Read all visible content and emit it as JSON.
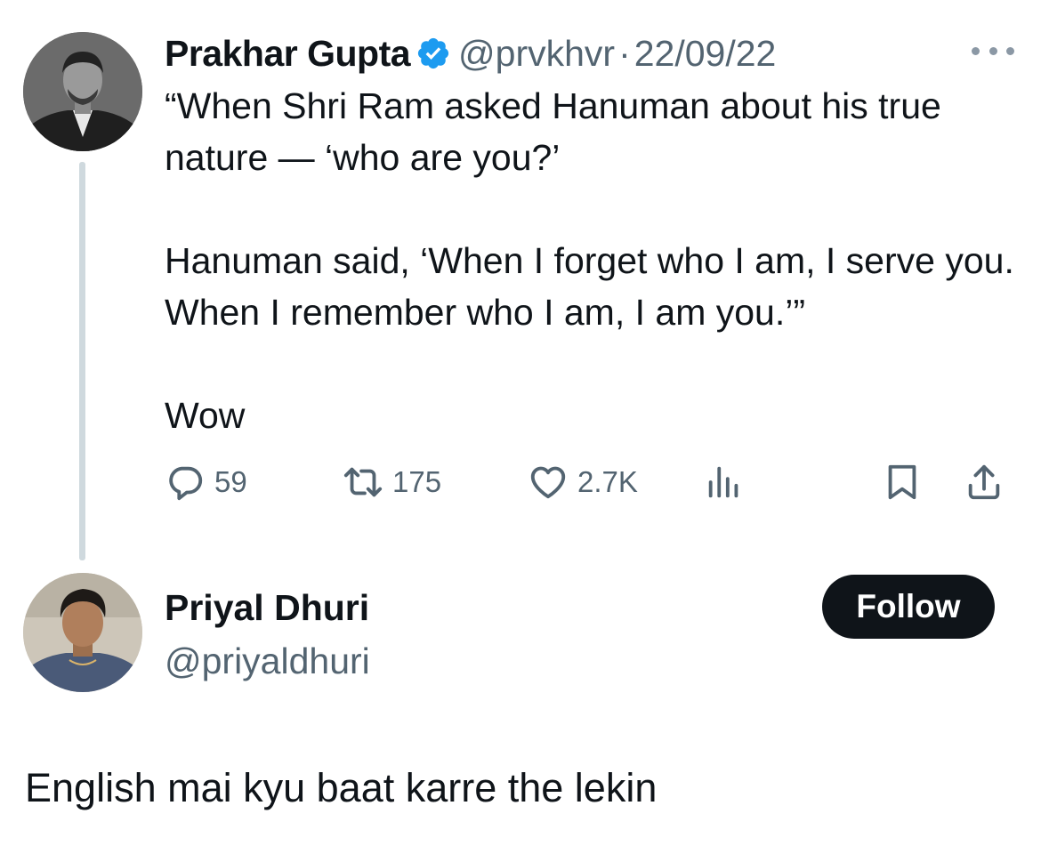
{
  "tweet": {
    "author_name": "Prakhar Gupta",
    "handle": "@prvkhvr",
    "separator": "·",
    "date": "22/09/22",
    "text": "“When Shri Ram asked Hanuman about his true nature — ‘who are you?’\n\nHanuman said, ‘When I forget who I am, I serve you. When I remember who I am, I am you.’”\n\nWow",
    "replies": "59",
    "retweets": "175",
    "likes": "2.7K"
  },
  "reply_user": {
    "name": "Priyal Dhuri",
    "handle": "@priyaldhuri",
    "follow_label": "Follow"
  },
  "reply_text": "English mai kyu baat karre the lekin",
  "colors": {
    "text": "#0f1419",
    "secondary": "#536471",
    "verified": "#1d9bf0",
    "thread_line": "#cfd9de",
    "follow_bg": "#0f1419"
  },
  "icons": {
    "verified": "verified-badge-icon",
    "more": "more-dots-icon",
    "reply": "reply-icon",
    "retweet": "retweet-icon",
    "like": "heart-icon",
    "views": "views-chart-icon",
    "bookmark": "bookmark-icon",
    "share": "share-icon"
  }
}
